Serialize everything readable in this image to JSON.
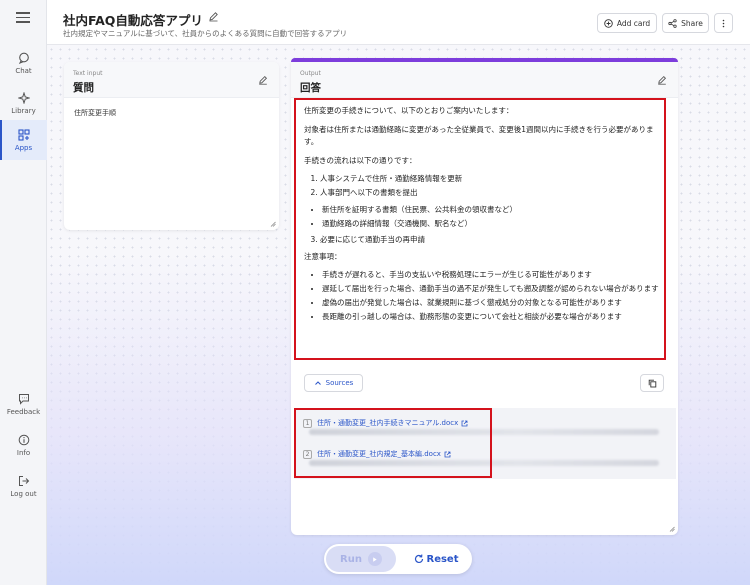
{
  "app": {
    "title": "社内FAQ自動応答アプリ",
    "description": "社内規定やマニュアルに基づいて、社員からのよくある質問に自動で回答するアプリ"
  },
  "header_actions": {
    "add_card": "Add card",
    "share": "Share"
  },
  "sidebar": {
    "items": [
      {
        "label": "Chat",
        "icon": "chat-icon"
      },
      {
        "label": "Library",
        "icon": "sparkle-icon"
      },
      {
        "label": "Apps",
        "icon": "apps-icon",
        "active": true
      },
      {
        "label": "Feedback",
        "icon": "feedback-icon"
      },
      {
        "label": "Info",
        "icon": "info-icon"
      },
      {
        "label": "Log out",
        "icon": "logout-icon"
      }
    ]
  },
  "input_card": {
    "type_label": "Text input",
    "title": "質問",
    "value": "住所変更手順"
  },
  "output_card": {
    "type_label": "Output",
    "title": "回答",
    "answer": {
      "intro": "住所変更の手続きについて、以下のとおりご案内いたします：",
      "target": "対象者は住所または通勤経路に変更があった全従業員で、変更後1週間以内に手続きを行う必要があります。",
      "flow_heading": "手続きの流れは以下の通りです：",
      "steps": [
        "人事システムで住所・通勤経路情報を更新",
        "人事部門へ以下の書類を提出"
      ],
      "documents": [
        "新住所を証明する書類（住民票、公共料金の領収書など）",
        "通勤経路の詳細情報（交通機関、駅名など）"
      ],
      "step3": "必要に応じて通勤手当の再申請",
      "notes_heading": "注意事項：",
      "notes": [
        "手続きが遅れると、手当の支払いや税務処理にエラーが生じる可能性があります",
        "遅延して届出を行った場合、通勤手当の過不足が発生しても遡及調整が認められない場合があります",
        "虚偽の届出が発覚した場合は、就業規則に基づく懲戒処分の対象となる可能性があります",
        "長距離の引っ越しの場合は、勤務形態の変更について会社と相談が必要な場合があります"
      ]
    },
    "sources_label": "Sources",
    "sources": [
      {
        "num": "1",
        "title": "住所・通勤変更_社内手続きマニュアル.docx"
      },
      {
        "num": "2",
        "title": "住所・通勤変更_社内規定_基本編.docx"
      }
    ]
  },
  "controls": {
    "run": "Run",
    "reset": "Reset"
  },
  "colors": {
    "accent": "#2a55c8",
    "output_bar": "#7d3ddc",
    "highlight": "#d4121c"
  }
}
